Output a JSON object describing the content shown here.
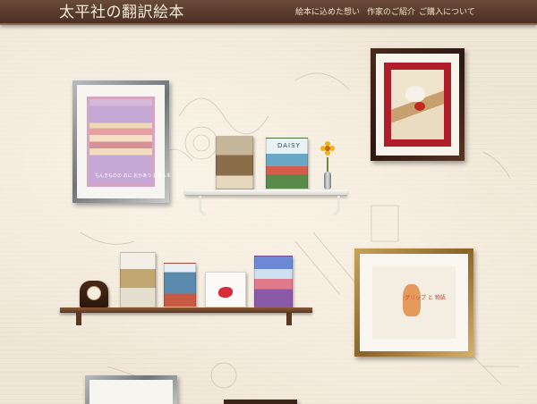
{
  "header": {
    "logo": {
      "part1": "太平社の翻訳",
      "part2": "絵本"
    },
    "nav": [
      {
        "label": "絵本に込めた想い"
      },
      {
        "label": "作家のご紹介"
      },
      {
        "label": "ご購入について"
      }
    ]
  },
  "artworks": {
    "moon_caption": "もんきものの おに おかあつ お話ろ本",
    "fox_caption": "グリップ と 物語"
  },
  "books": {
    "daisy_title": "DAISY"
  },
  "colors": {
    "header_bg": "#5a3a2a",
    "page_bg": "#efe6d6",
    "mat_red": "#b01e2a"
  }
}
